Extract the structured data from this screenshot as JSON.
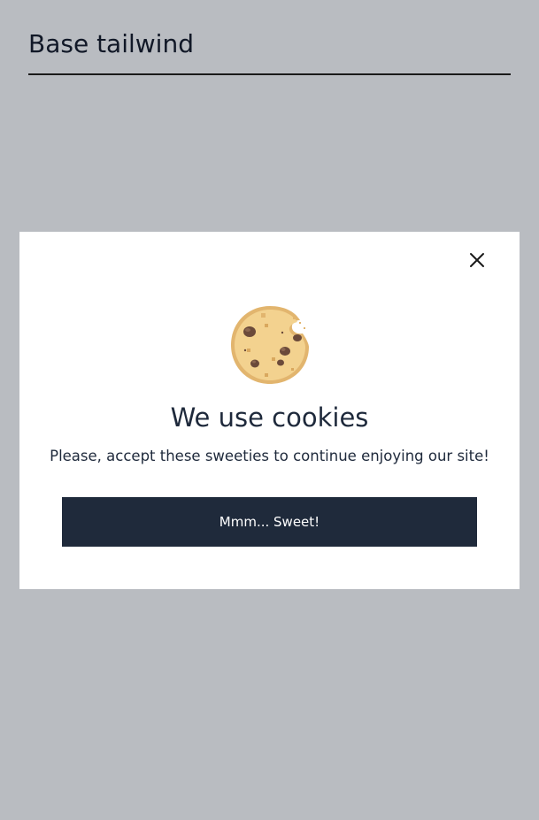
{
  "page": {
    "title": "Base tailwind"
  },
  "modal": {
    "icon": "cookie-icon",
    "close_icon": "close-icon",
    "title": "We use cookies",
    "message": "Please, accept these sweeties to continue enjoying our site!",
    "accept_label": "Mmm... Sweet!"
  },
  "colors": {
    "backdrop": "#b9bcc1",
    "modal_bg": "#ffffff",
    "button_bg": "#1f2a3b",
    "text": "#1e293b"
  }
}
